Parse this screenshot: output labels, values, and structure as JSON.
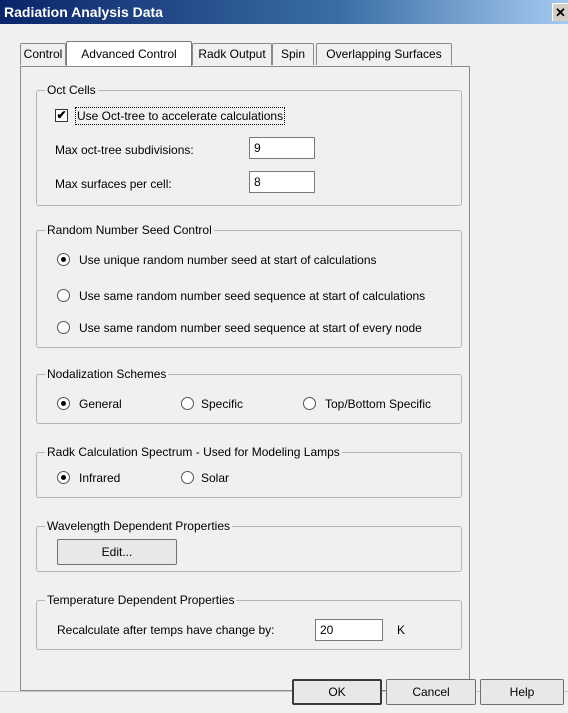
{
  "window": {
    "title": "Radiation Analysis Data",
    "close_glyph": "✕"
  },
  "tabs": [
    {
      "label": "Control",
      "active": false
    },
    {
      "label": "Advanced Control",
      "active": true
    },
    {
      "label": "Radk Output",
      "active": false
    },
    {
      "label": "Spin",
      "active": false
    },
    {
      "label": "Overlapping Surfaces",
      "active": false
    }
  ],
  "oct_cells": {
    "title": "Oct Cells",
    "use_octree_label": "Use Oct-tree to accelerate calculations",
    "use_octree_checked": true,
    "max_subdivisions_label": "Max oct-tree subdivisions:",
    "max_subdivisions_value": "9",
    "max_surfaces_label": "Max surfaces per cell:",
    "max_surfaces_value": "8"
  },
  "seed_control": {
    "title": "Random Number Seed Control",
    "options": [
      {
        "label": "Use unique random number seed at start of calculations",
        "checked": true
      },
      {
        "label": "Use same random number seed sequence at start of calculations",
        "checked": false
      },
      {
        "label": "Use same random number seed sequence at start of every node",
        "checked": false
      }
    ]
  },
  "nodalization": {
    "title": "Nodalization Schemes",
    "options": [
      {
        "label": "General",
        "checked": true
      },
      {
        "label": "Specific",
        "checked": false
      },
      {
        "label": "Top/Bottom Specific",
        "checked": false
      }
    ]
  },
  "spectrum": {
    "title": "Radk Calculation Spectrum - Used for Modeling Lamps",
    "options": [
      {
        "label": "Infrared",
        "checked": true
      },
      {
        "label": "Solar",
        "checked": false
      }
    ]
  },
  "wavelength": {
    "title": "Wavelength Dependent Properties",
    "edit_label": "Edit..."
  },
  "temperature": {
    "title": "Temperature Dependent Properties",
    "recalc_label": "Recalculate after temps have change by:",
    "recalc_value": "20",
    "unit": "K"
  },
  "footer": {
    "ok_label": "OK",
    "cancel_label": "Cancel",
    "help_label": "Help"
  }
}
